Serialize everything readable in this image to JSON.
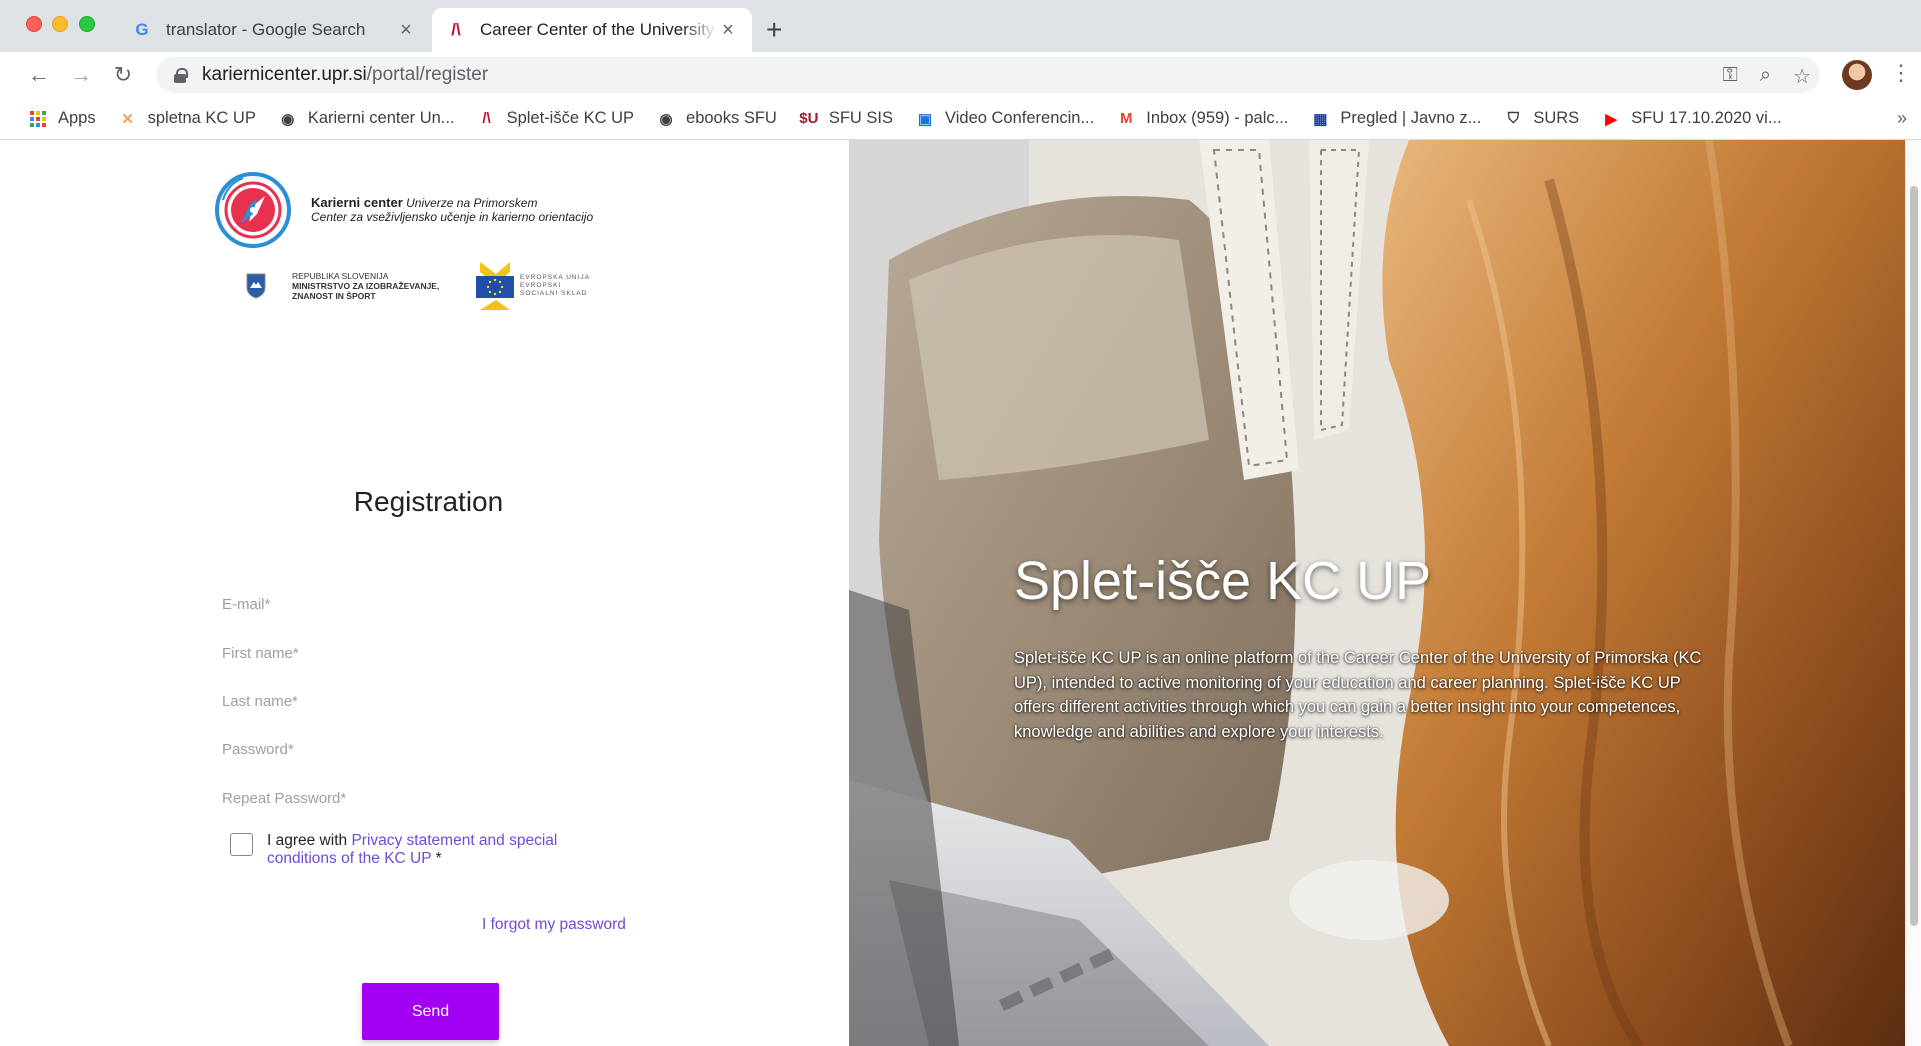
{
  "tabs": [
    {
      "title": "translator - Google Search",
      "favicon": "G",
      "active": false
    },
    {
      "title": "Career Center of the University of Primorska",
      "favicon": "/\\",
      "active": true
    }
  ],
  "new_tab_symbol": "+",
  "address": {
    "host": "kariernicenter.upr.si",
    "path": "/portal/register"
  },
  "bookmarks": [
    {
      "label": "Apps",
      "icon": "apps-grid-icon"
    },
    {
      "label": "spletna KC UP",
      "icon": "kc-web-icon"
    },
    {
      "label": "Karierni center Un...",
      "icon": "globe-icon"
    },
    {
      "label": "Splet-išče KC UP",
      "icon": "kcup-logo-icon"
    },
    {
      "label": "ebooks SFU",
      "icon": "globe-icon"
    },
    {
      "label": "SFU SIS",
      "icon": "sfu-icon"
    },
    {
      "label": "Video Conferencin...",
      "icon": "video-icon"
    },
    {
      "label": "Inbox (959) - palc...",
      "icon": "gmail-icon"
    },
    {
      "label": "Pregled | Javno z...",
      "icon": "eu-flag-icon"
    },
    {
      "label": "SURS",
      "icon": "surs-icon"
    },
    {
      "label": "SFU 17.10.2020 vi...",
      "icon": "youtube-icon"
    }
  ],
  "logo": {
    "brand": "Karierni center",
    "brand_tail": "Univerze na Primorskem",
    "tagline": "Center za vseživljensko učenje in karierno orientacijo",
    "ministry_lines": [
      "REPUBLIKA SLOVENIJA",
      "MINISTRSTVO ZA IZOBRAŽEVANJE,",
      "ZNANOST IN ŠPORT"
    ],
    "eu_lines": [
      "EVROPSKA UNIJA",
      "EVROPSKI",
      "SOCIALNI SKLAD"
    ]
  },
  "form": {
    "title": "Registration",
    "email_placeholder": "E-mail*",
    "first_name_placeholder": "First name*",
    "last_name_placeholder": "Last name*",
    "password_placeholder": "Password*",
    "repeat_password_placeholder": "Repeat Password*",
    "agree_prefix": "I agree with ",
    "agree_link": "Privacy statement and special conditions of the KC UP",
    "agree_suffix": " *",
    "forgot_link": "I forgot my password",
    "send_label": "Send"
  },
  "hero": {
    "title": "Splet-išče KC UP",
    "body": "Splet-išče KC UP is an online platform of the Career Center of the University of Primorska (KC UP), intended to active monitoring of your education and career planning. Splet-išče KC UP offers different activities through which you can gain a better insight into your competences, knowledge and abilities and explore your interests."
  },
  "colors": {
    "accent": "#a100f2",
    "link": "#6e4bd8"
  }
}
